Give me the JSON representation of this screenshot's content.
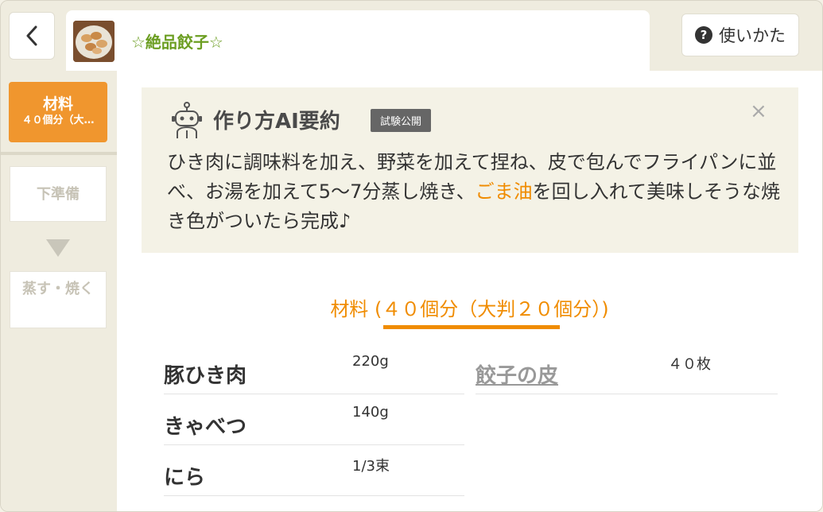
{
  "header": {
    "title": "☆絶品餃子☆",
    "help_label": "使いかた",
    "help_icon": "?"
  },
  "sidebar": {
    "active": {
      "label": "材料",
      "sub": "４０個分（大…"
    },
    "items": [
      {
        "label": "下準備"
      },
      {
        "label": "蒸す・焼く"
      }
    ]
  },
  "ai_summary": {
    "title": "作り方AI要約",
    "badge": "試験公開",
    "close": "×",
    "text_before": "ひき肉に調味料を加え、野菜を加えて捏ね、皮で包んでフライパンに並べ、お湯を加えて5〜7分蒸し焼き、",
    "link_text": "ごま油",
    "text_after": "を回し入れて美味しそうな焼き色がついたら完成♪"
  },
  "ingredients": {
    "heading": "材料 (４０個分（大判２０個分）)",
    "items": [
      {
        "name": "豚ひき肉",
        "qty": "220g"
      },
      {
        "name": "きゃべつ",
        "qty": "140g"
      },
      {
        "name": "にら",
        "qty": "1/3束"
      },
      {
        "name": "餃子の皮",
        "qty": "４０枚"
      }
    ]
  },
  "colors": {
    "accent": "#f08c00",
    "active_tab": "#f0962e",
    "title_green": "#6c9e22"
  }
}
